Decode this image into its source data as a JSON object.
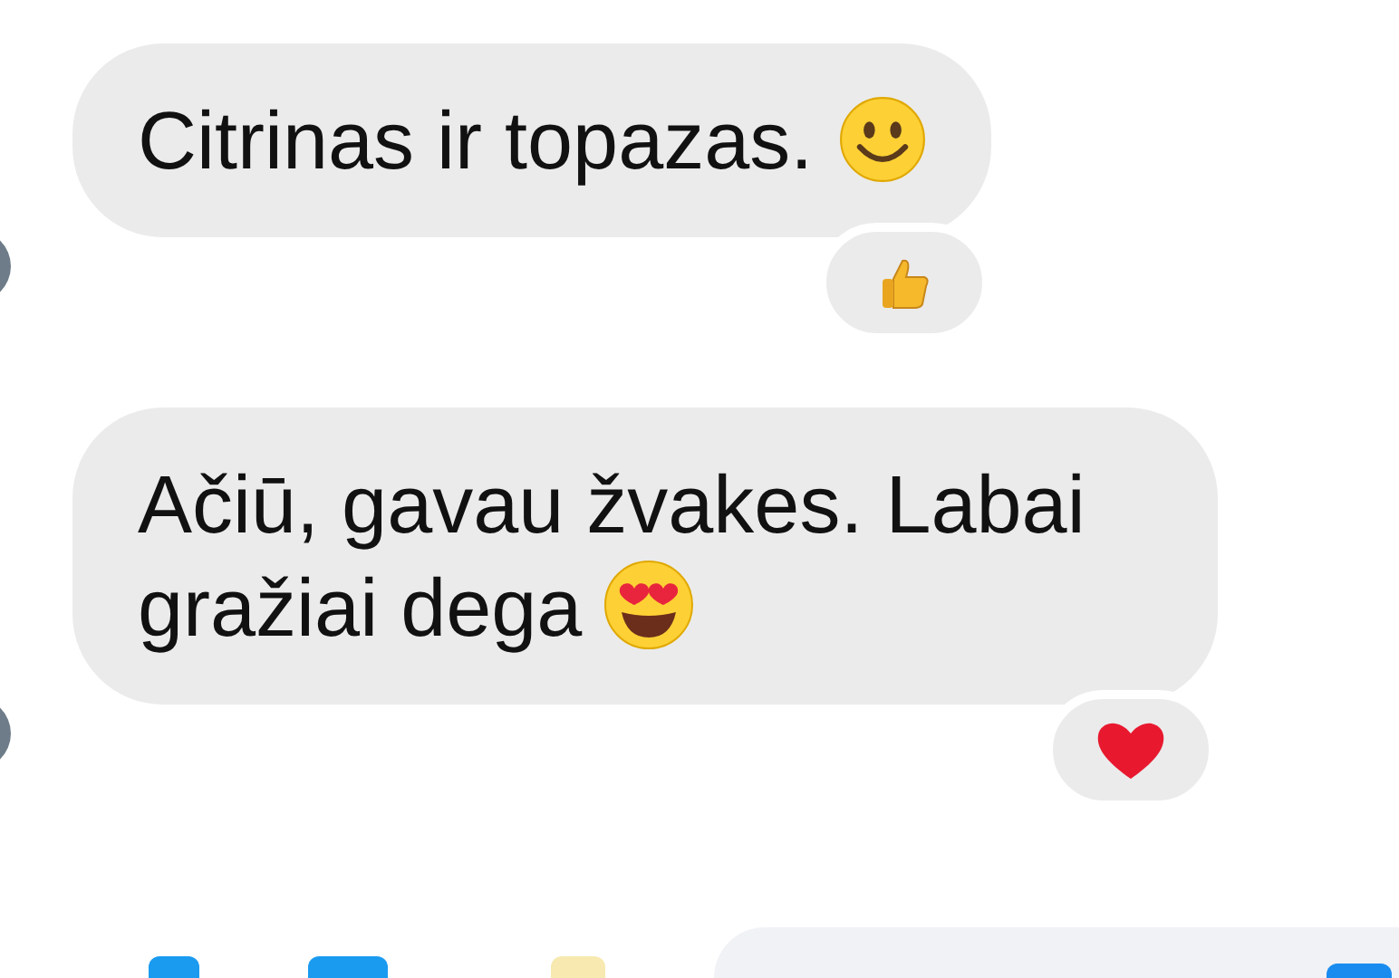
{
  "messages": [
    {
      "text": "Citrinas ir topazas.",
      "emoji": {
        "kind": "smile"
      },
      "reaction": {
        "kind": "like"
      }
    },
    {
      "text": "Ačiū, gavau žvakes. Labai gražiai dega",
      "emoji": {
        "kind": "heart-eyes"
      },
      "reaction": {
        "kind": "heart"
      }
    }
  ]
}
